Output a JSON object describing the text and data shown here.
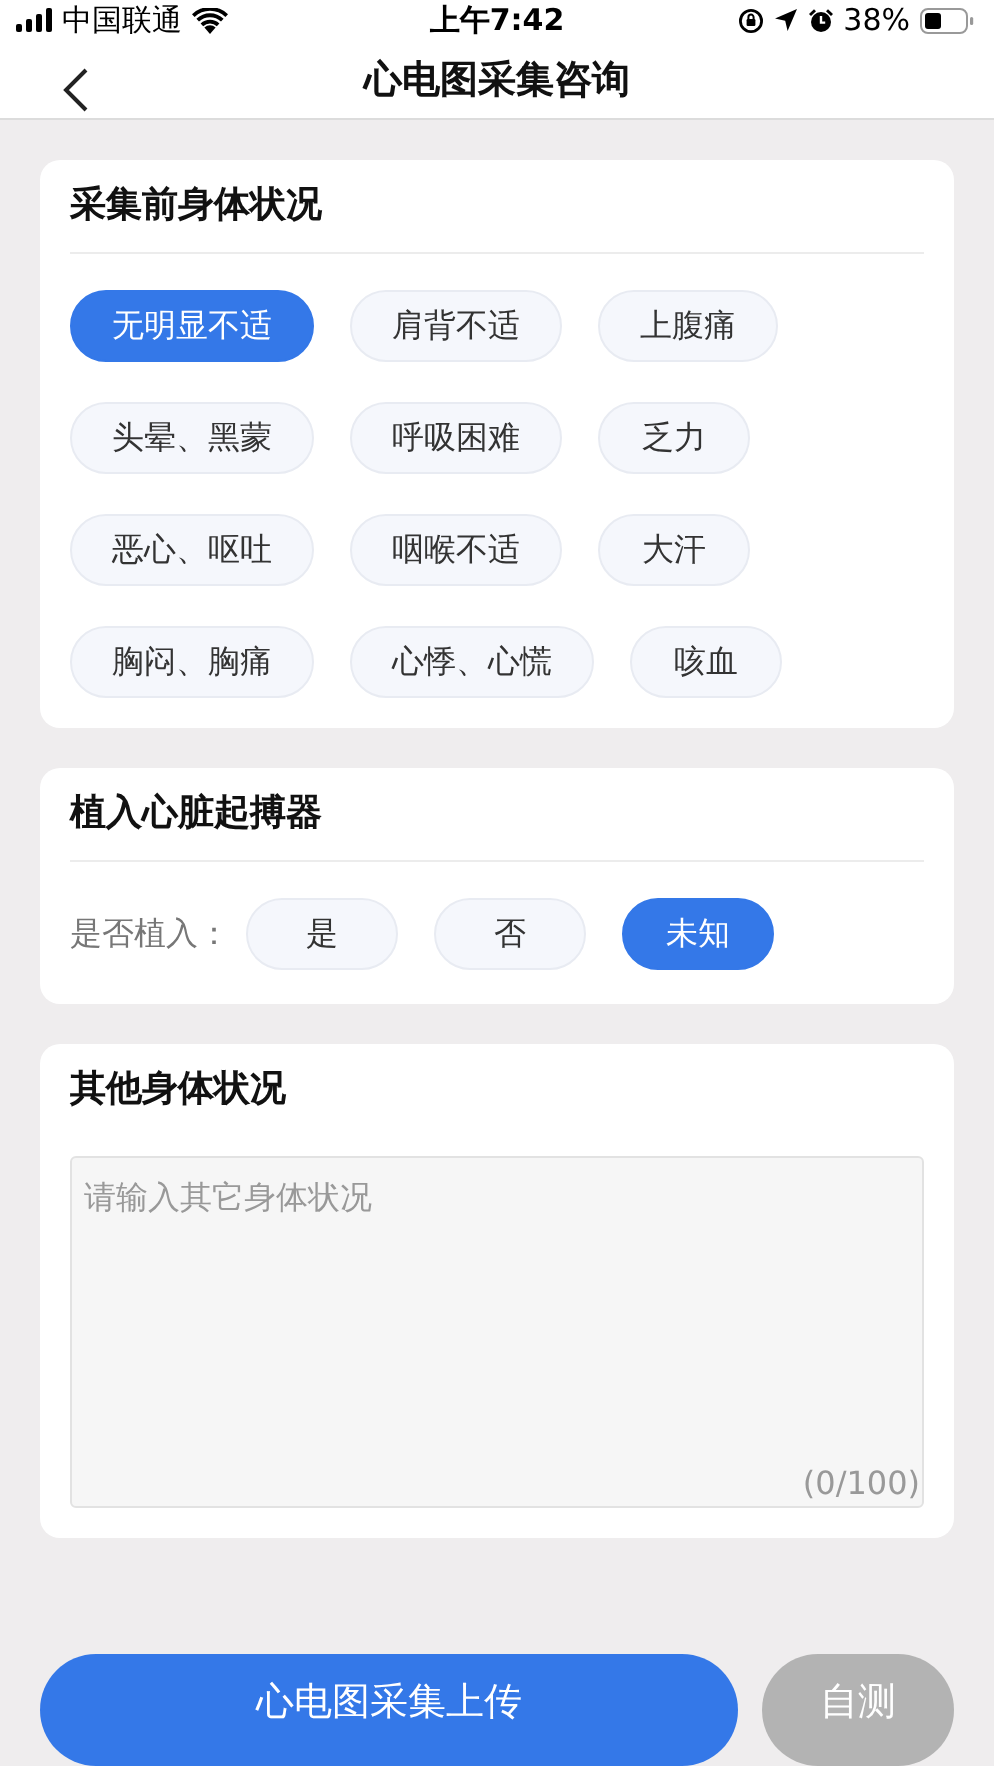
{
  "status_bar": {
    "carrier": "中国联通",
    "time": "上午7:42",
    "battery": "38%"
  },
  "nav": {
    "title": "心电图采集咨询"
  },
  "symptoms": {
    "title": "采集前身体状况",
    "options": [
      {
        "label": "无明显不适",
        "selected": true
      },
      {
        "label": "肩背不适",
        "selected": false
      },
      {
        "label": "上腹痛",
        "selected": false
      },
      {
        "label": "头晕、黑蒙",
        "selected": false
      },
      {
        "label": "呼吸困难",
        "selected": false
      },
      {
        "label": "乏力",
        "selected": false
      },
      {
        "label": "恶心、呕吐",
        "selected": false
      },
      {
        "label": "咽喉不适",
        "selected": false
      },
      {
        "label": "大汗",
        "selected": false
      },
      {
        "label": "胸闷、胸痛",
        "selected": false
      },
      {
        "label": "心悸、心慌",
        "selected": false
      },
      {
        "label": "咳血",
        "selected": false
      }
    ]
  },
  "pacemaker": {
    "title": "植入心脏起搏器",
    "label": "是否植入：",
    "options": [
      {
        "label": "是",
        "selected": false
      },
      {
        "label": "否",
        "selected": false
      },
      {
        "label": "未知",
        "selected": true
      }
    ]
  },
  "other": {
    "title": "其他身体状况",
    "placeholder": "请输入其它身体状况",
    "counter": "(0/100)"
  },
  "buttons": [
    {
      "label": "心电图采集上传",
      "disabled": false
    },
    {
      "label": "自测",
      "disabled": true
    }
  ]
}
